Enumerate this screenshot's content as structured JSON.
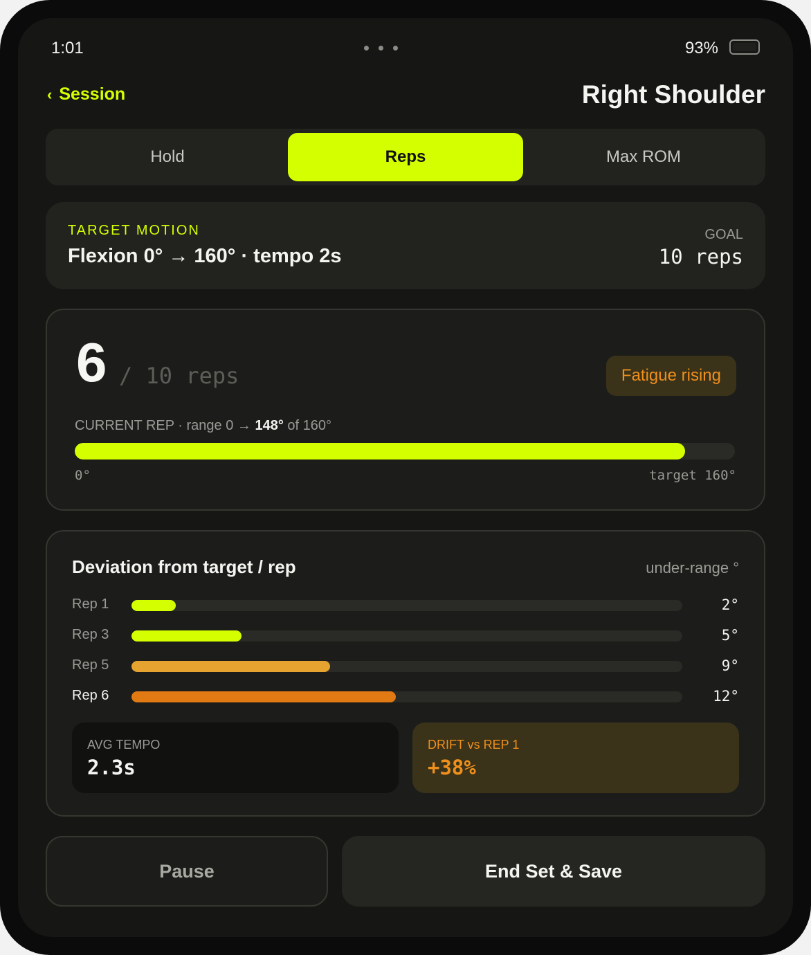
{
  "status": {
    "time": "1:01",
    "battery": "93%"
  },
  "header": {
    "back_label": "Session",
    "title": "Right Shoulder"
  },
  "tabs": [
    {
      "label": "Hold",
      "active": false
    },
    {
      "label": "Reps",
      "active": true
    },
    {
      "label": "Max ROM",
      "active": false
    }
  ],
  "target": {
    "label": "TARGET MOTION",
    "motion": "Flexion 0° → 160° · tempo 2s",
    "goal_label": "GOAL",
    "goal_value": "10 reps"
  },
  "progress": {
    "count": "6",
    "of_text": "/ 10 reps",
    "badge": "Fatigue rising",
    "info_prefix": "CURRENT REP · range 0 → ",
    "info_value": "148°",
    "info_suffix": " of 160°",
    "current_deg": 148,
    "target_deg": 160,
    "min_label": "0°",
    "max_label": "target 160°"
  },
  "deviation": {
    "title": "Deviation from target / rep",
    "unit": "under-range °",
    "max_scale": 25,
    "reps": [
      {
        "label": "Rep 1",
        "value": 2,
        "display": "2°",
        "color": "#d4ff00"
      },
      {
        "label": "Rep 3",
        "value": 5,
        "display": "5°",
        "color": "#d4ff00"
      },
      {
        "label": "Rep 5",
        "value": 9,
        "display": "9°",
        "color": "#e7a330"
      },
      {
        "label": "Rep 6",
        "value": 12,
        "display": "12°",
        "color": "#e27a14"
      }
    ]
  },
  "stats": {
    "avg_tempo_label": "AVG TEMPO",
    "avg_tempo_value": "2.3s",
    "drift_label": "DRIFT vs REP 1",
    "drift_value": "+38%"
  },
  "buttons": {
    "pause": "Pause",
    "end": "End Set & Save"
  },
  "colors": {
    "accent": "#d4ff00",
    "warning": "#ef8f1c",
    "background": "#161714"
  }
}
